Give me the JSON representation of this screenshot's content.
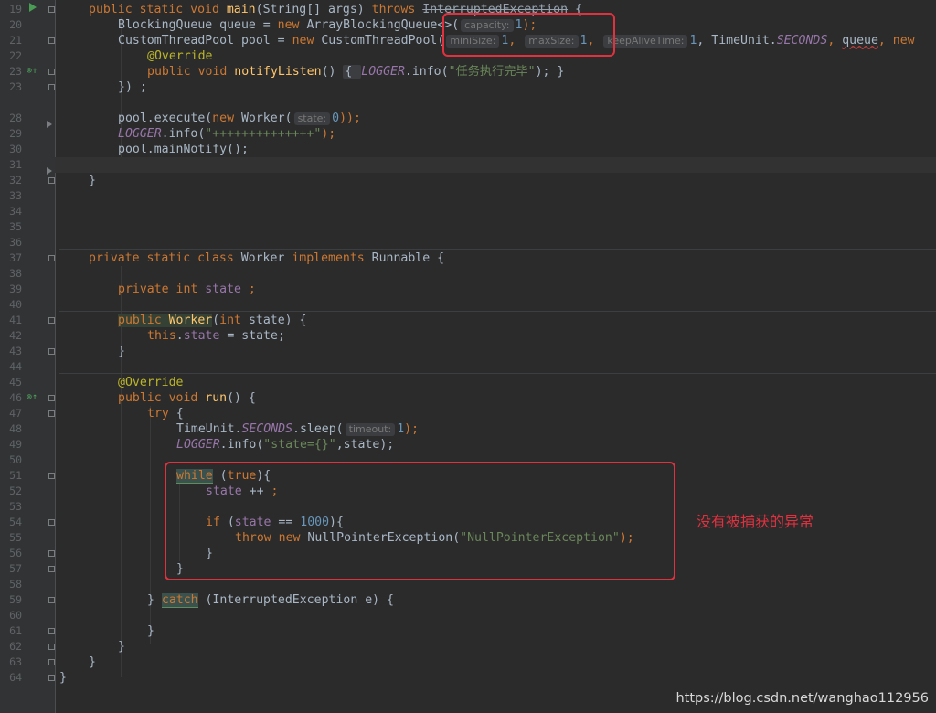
{
  "gutter": {
    "line_numbers": [
      "19",
      "20",
      "21",
      "22",
      "23",
      "23",
      "28",
      "29",
      "30",
      "31",
      "32",
      "33",
      "34",
      "35",
      "36",
      "37",
      "38",
      "39",
      "40",
      "41",
      "42",
      "43",
      "44",
      "45",
      "46",
      "47",
      "48",
      "49",
      "50",
      "51",
      "52",
      "53",
      "54",
      "55",
      "56",
      "57",
      "58",
      "59",
      "60",
      "61",
      "62",
      "63",
      "64"
    ]
  },
  "code": {
    "l19": {
      "a": "public static void ",
      "fn": "main",
      "b": "(String[] args) ",
      "kw": "throws ",
      "c": "InterruptedException",
      "d": " {"
    },
    "l20": {
      "a": "BlockingQueue queue = ",
      "kw": "new ",
      "b": "ArrayBlockingQueue<>(",
      "hint": "capacity:",
      "num": "1",
      "c": ");"
    },
    "l21": {
      "a": "CustomThreadPool pool = ",
      "kw": "new ",
      "b": "CustomThreadPool(",
      "h1": "miniSize:",
      "n1": "1",
      "c1": ",",
      "h2": "maxSize:",
      "n2": "1",
      "c2": ",",
      "h3": "keepAliveTime:",
      "n3": "1",
      "c3": ", TimeUnit.",
      "sf": "SECONDS",
      "c4": ", ",
      "q": "queue",
      "c5": ", ",
      "kw2": "new"
    },
    "l22": {
      "ann": "@Override"
    },
    "l23": {
      "kw": "public void ",
      "fn": "notifyListen",
      "a": "() ",
      "b1": "{ ",
      "sf": "LOGGER",
      "b": ".info(",
      "str": "\"任务执行完毕\"",
      "c": "); }"
    },
    "l23b": {
      "a": "}) ;"
    },
    "l28": {
      "a": "pool.execute(",
      "kw": "new ",
      "b": "Worker(",
      "hint": "state:",
      "num": "0",
      "c": "));"
    },
    "l29": {
      "sf": "LOGGER",
      "a": ".info(",
      "str": "\"++++++++++++++\"",
      "b": ");"
    },
    "l30": {
      "a": "pool.mainNotify();"
    },
    "l32": {
      "a": "}"
    },
    "l37": {
      "kw": "private static class ",
      "a": "Worker ",
      "kw2": "implements ",
      "b": "Runnable {"
    },
    "l39": {
      "kw": "private int ",
      "fld": "state",
      "a": " ;"
    },
    "l41": {
      "kw": "public ",
      "fn": "Worker",
      "a": "(",
      "kw2": "int ",
      "b": "state) {"
    },
    "l42": {
      "kw": "this",
      "a": ".",
      "fld": "state",
      "b": " = state;"
    },
    "l43": {
      "a": "}"
    },
    "l45": {
      "ann": "@Override"
    },
    "l46": {
      "kw": "public void ",
      "fn": "run",
      "a": "() {"
    },
    "l47": {
      "kw": "try",
      "a": " {"
    },
    "l48": {
      "a": "TimeUnit.",
      "sf": "SECONDS",
      "b": ".sleep(",
      "hint": "timeout:",
      "num": "1",
      "c": ");"
    },
    "l49": {
      "sf": "LOGGER",
      "a": ".info(",
      "str": "\"state={}\"",
      "b": ",state);"
    },
    "l51": {
      "kw": "while",
      "a": " (",
      "kw2": "true",
      "b": "){"
    },
    "l52": {
      "fld": "state",
      "a": " ++ ",
      "kw": ";"
    },
    "l54": {
      "kw": "if",
      "a": " (",
      "fld": "state",
      "b": " == ",
      "num": "1000",
      "c": "){"
    },
    "l55": {
      "kw": "throw new ",
      "a": "NullPointerException(",
      "str": "\"NullPointerException\"",
      "b": ");"
    },
    "l56": {
      "a": "}"
    },
    "l57": {
      "a": "}"
    },
    "l59": {
      "a": "} ",
      "kw": "catch",
      "b": " (InterruptedException e) {"
    },
    "l61": {
      "a": "}"
    },
    "l62": {
      "a": "}"
    },
    "l63": {
      "a": "}"
    },
    "l64": {
      "a": "}"
    }
  },
  "annotation_note": "没有被捕获的异常",
  "watermark": "https://blog.csdn.net/wanghao112956",
  "colors": {
    "background": "#2b2b2b",
    "keyword": "#cc7832",
    "string": "#6a8759",
    "number": "#6897bb",
    "highlight_box": "#e0313f"
  }
}
